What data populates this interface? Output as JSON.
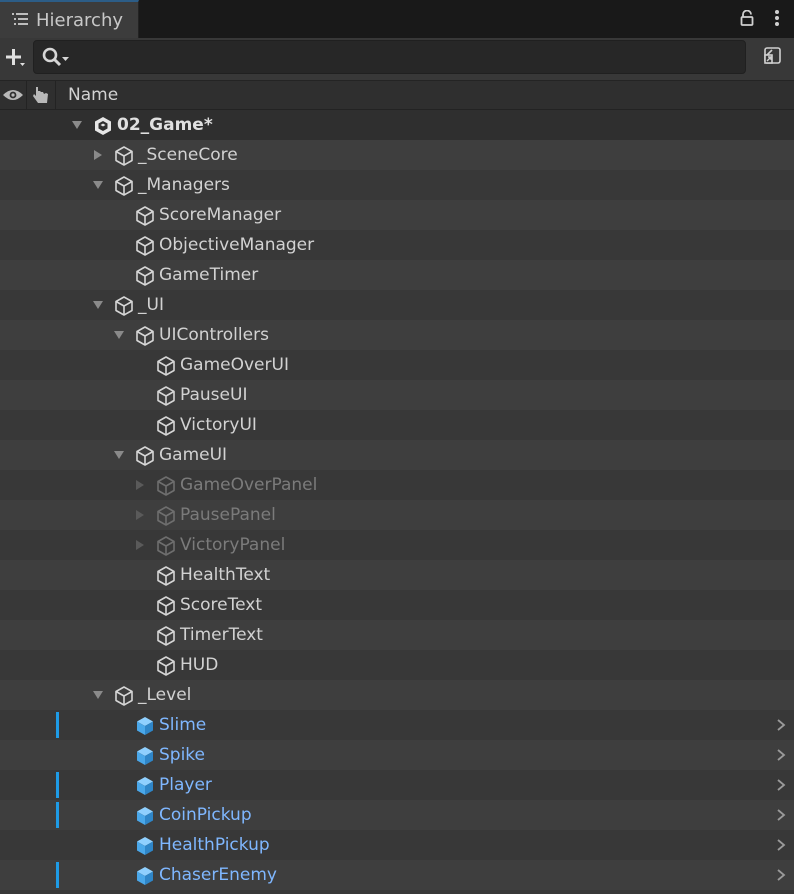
{
  "panel": {
    "title": "Hierarchy",
    "column_name": "Name"
  },
  "search": {
    "value": "",
    "placeholder": ""
  },
  "colors": {
    "accent": "#2c5d87",
    "prefab_blue": "#7fb7ff",
    "override_bar": "#1e9be6",
    "inactive_text": "#7b7b7b"
  },
  "icons": {
    "tab": "list-icon",
    "lock": "lock-icon",
    "menu": "kebab-menu-icon",
    "add": "plus-icon",
    "search": "search-icon",
    "scene_visibility": "scene-visibility-icon",
    "eye": "eye-icon",
    "pick": "hand-icon"
  },
  "tree": [
    {
      "label": "02_Game*",
      "depth": 0,
      "expand": "open",
      "kind": "scene"
    },
    {
      "label": "_SceneCore",
      "depth": 1,
      "expand": "closed",
      "kind": "object"
    },
    {
      "label": "_Managers",
      "depth": 1,
      "expand": "open",
      "kind": "object"
    },
    {
      "label": "ScoreManager",
      "depth": 2,
      "expand": "none",
      "kind": "object"
    },
    {
      "label": "ObjectiveManager",
      "depth": 2,
      "expand": "none",
      "kind": "object"
    },
    {
      "label": "GameTimer",
      "depth": 2,
      "expand": "none",
      "kind": "object"
    },
    {
      "label": "_UI",
      "depth": 1,
      "expand": "open",
      "kind": "object"
    },
    {
      "label": "UIControllers",
      "depth": 2,
      "expand": "open",
      "kind": "object"
    },
    {
      "label": "GameOverUI",
      "depth": 3,
      "expand": "none",
      "kind": "object"
    },
    {
      "label": "PauseUI",
      "depth": 3,
      "expand": "none",
      "kind": "object"
    },
    {
      "label": "VictoryUI",
      "depth": 3,
      "expand": "none",
      "kind": "object"
    },
    {
      "label": "GameUI",
      "depth": 2,
      "expand": "open",
      "kind": "object"
    },
    {
      "label": "GameOverPanel",
      "depth": 3,
      "expand": "closed",
      "kind": "inactive"
    },
    {
      "label": "PausePanel",
      "depth": 3,
      "expand": "closed",
      "kind": "inactive"
    },
    {
      "label": "VictoryPanel",
      "depth": 3,
      "expand": "closed",
      "kind": "inactive"
    },
    {
      "label": "HealthText",
      "depth": 3,
      "expand": "none",
      "kind": "object"
    },
    {
      "label": "ScoreText",
      "depth": 3,
      "expand": "none",
      "kind": "object"
    },
    {
      "label": "TimerText",
      "depth": 3,
      "expand": "none",
      "kind": "object"
    },
    {
      "label": "HUD",
      "depth": 3,
      "expand": "none",
      "kind": "object"
    },
    {
      "label": "_Level",
      "depth": 1,
      "expand": "open",
      "kind": "object"
    },
    {
      "label": "Slime",
      "depth": 2,
      "expand": "none",
      "kind": "prefab",
      "override": true
    },
    {
      "label": "Spike",
      "depth": 2,
      "expand": "none",
      "kind": "prefab",
      "override": false
    },
    {
      "label": "Player",
      "depth": 2,
      "expand": "none",
      "kind": "prefab",
      "override": true
    },
    {
      "label": "CoinPickup",
      "depth": 2,
      "expand": "none",
      "kind": "prefab",
      "override": true
    },
    {
      "label": "HealthPickup",
      "depth": 2,
      "expand": "none",
      "kind": "prefab",
      "override": false
    },
    {
      "label": "ChaserEnemy",
      "depth": 2,
      "expand": "none",
      "kind": "prefab",
      "override": true
    }
  ]
}
